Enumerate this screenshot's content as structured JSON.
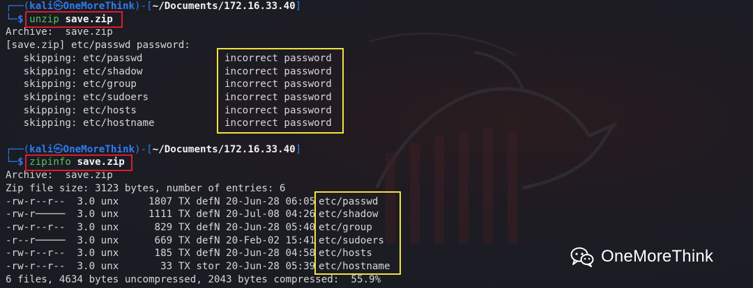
{
  "colors": {
    "background": "#1b1c24",
    "prompt_blue": "#2f7cf2",
    "command_green": "#58c15c",
    "text": "#d7d7d7",
    "highlight_red": "#e01b2a",
    "highlight_yellow": "#f2e43b"
  },
  "prompt1": {
    "frame_open": "┌──(",
    "user": "kali",
    "at_icon": "㉿",
    "host": "OneMoreThink",
    "frame_mid": ")-[",
    "dir": "~/Documents/172.16.33.40",
    "frame_close": "]",
    "dollar_line": "└─$",
    "cmd": "unzip",
    "arg": "save.zip"
  },
  "unzip_output": {
    "archive": "Archive:  save.zip",
    "password_prompt": "[save.zip] etc/passwd password:",
    "rows": [
      {
        "skip": "   skipping: etc/passwd",
        "status": "incorrect password"
      },
      {
        "skip": "   skipping: etc/shadow",
        "status": "incorrect password"
      },
      {
        "skip": "   skipping: etc/group",
        "status": "incorrect password"
      },
      {
        "skip": "   skipping: etc/sudoers",
        "status": "incorrect password"
      },
      {
        "skip": "   skipping: etc/hosts",
        "status": "incorrect password"
      },
      {
        "skip": "   skipping: etc/hostname",
        "status": "incorrect password"
      }
    ]
  },
  "prompt2": {
    "frame_open": "┌──(",
    "user": "kali",
    "at_icon": "㉿",
    "host": "OneMoreThink",
    "frame_mid": ")-[",
    "dir": "~/Documents/172.16.33.40",
    "frame_close": "]",
    "dollar_line": "└─$",
    "cmd": "zipinfo",
    "arg": "save.zip"
  },
  "zipinfo_output": {
    "archive": "Archive:  save.zip",
    "summary": "Zip file size: 3123 bytes, number of entries: 6",
    "rows": [
      {
        "meta": "-rw-r--r--  3.0 unx     1807 TX defN 20-Jun-28 06:05",
        "name": "etc/passwd"
      },
      {
        "meta": "-rw-r─────  3.0 unx     1111 TX defN 20-Jul-08 04:26",
        "name": "etc/shadow"
      },
      {
        "meta": "-rw-r--r--  3.0 unx      829 TX defN 20-Jun-28 05:40",
        "name": "etc/group"
      },
      {
        "meta": "-r--r─────  3.0 unx      669 TX defN 20-Feb-02 15:41",
        "name": "etc/sudoers"
      },
      {
        "meta": "-rw-r--r--  3.0 unx      185 TX defN 20-Jun-28 04:58",
        "name": "etc/hosts"
      },
      {
        "meta": "-rw-r--r--  3.0 unx       33 TX stor 20-Jun-28 05:39",
        "name": "etc/hostname"
      }
    ],
    "footer": "6 files, 4634 bytes uncompressed, 2043 bytes compressed:  55.9%"
  },
  "watermark": {
    "icon": "wechat-icon",
    "text": "OneMoreThink"
  }
}
